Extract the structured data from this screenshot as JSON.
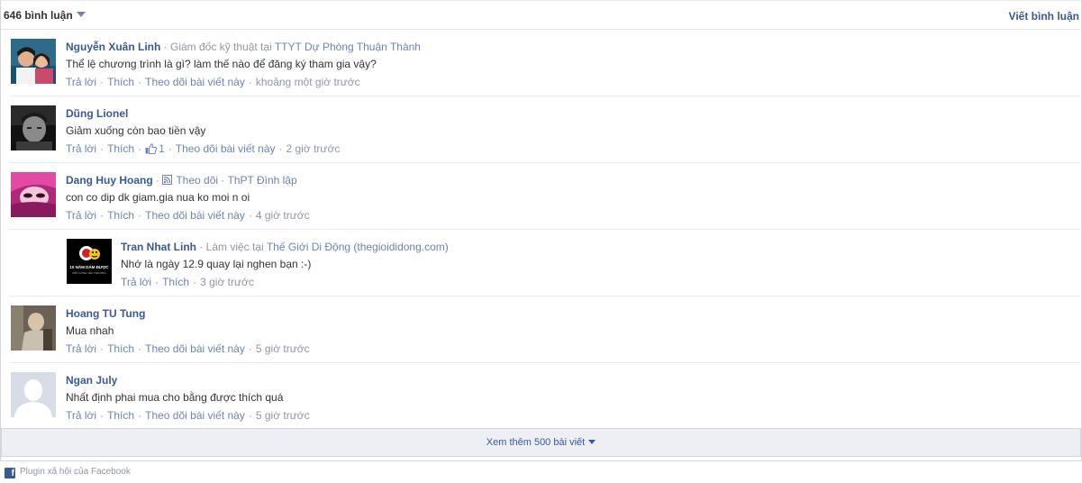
{
  "header": {
    "count_label": "646 bình luận",
    "write_label": "Viết bình luận"
  },
  "labels": {
    "reply": "Trả lời",
    "like": "Thích",
    "follow_post": "Theo dõi bài viết này",
    "follow": "Theo dõi"
  },
  "comments": [
    {
      "name": "Nguyễn Xuân Linh",
      "meta_prefix": " · Giám đốc kỹ thuật tại ",
      "meta_link": "TTYT Dự Phòng Thuận Thành",
      "text": "Thể lệ chương trình là gì? làm thế nào để đăng ký tham gia vậy?",
      "time": "khoảng một giờ trước"
    },
    {
      "name": "Dũng Lionel",
      "text": "Giảm xuống còn bao tiền vậy",
      "like_count": "1",
      "time": "2 giờ trước"
    },
    {
      "name": "Dang Huy Hoang",
      "meta_link": "ThPT Đình lập",
      "text": "con co dip dk giam.gia nua ko moi n oi",
      "time": "4 giờ trước"
    },
    {
      "name": "Tran Nhat Linh",
      "meta_prefix": " · Làm việc tại ",
      "meta_link": "Thế Giới Di Động (thegioididong.com)",
      "text": "Nhớ là ngày 12.9 quay lại nghen bạn :-)",
      "time": "3 giờ trước",
      "avatar_text": "10 NĂM DÁM ĐƯỢC",
      "avatar_subtext": "MỘT LÒNG YÊU THƯƠNG"
    },
    {
      "name": "Hoang TU Tung",
      "text": "Mua nhah",
      "time": "5 giờ trước"
    },
    {
      "name": "Ngan July",
      "text": "Nhất định phai mua cho bằng được thích quá",
      "time": "5 giờ trước"
    }
  ],
  "more_label": "Xem thêm 500 bài viết",
  "footer_label": "Plugin xã hội của Facebook",
  "colors": {
    "link": "#3b5998",
    "meta": "#9197a3",
    "action": "#6d84b4",
    "divider": "#e9eaed"
  }
}
